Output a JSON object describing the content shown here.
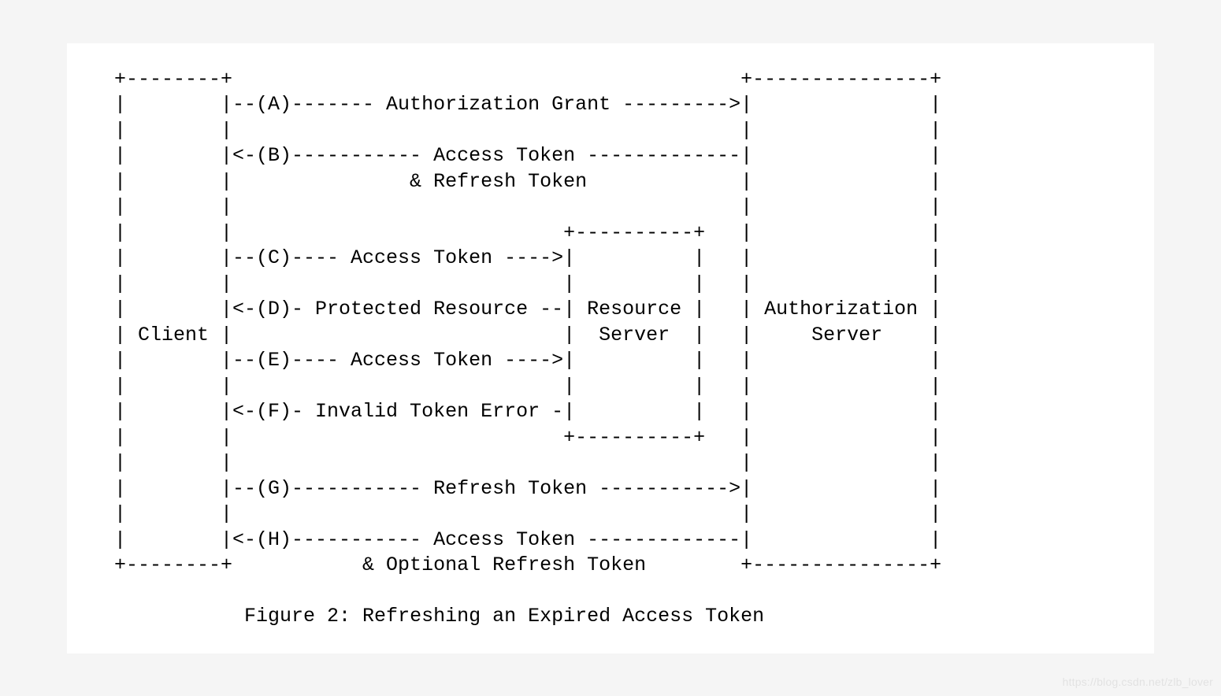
{
  "diagram": {
    "ascii": "+--------+                                           +---------------+\n|        |--(A)------- Authorization Grant --------->|               |\n|        |                                           |               |\n|        |<-(B)----------- Access Token -------------|               |\n|        |               & Refresh Token             |               |\n|        |                                           |               |\n|        |                            +----------+   |               |\n|        |--(C)---- Access Token ---->|          |   |               |\n|        |                            |          |   |               |\n|        |<-(D)- Protected Resource --| Resource |   | Authorization |\n| Client |                            |  Server  |   |     Server    |\n|        |--(E)---- Access Token ---->|          |   |               |\n|        |                            |          |   |               |\n|        |<-(F)- Invalid Token Error -|          |   |               |\n|        |                            +----------+   |               |\n|        |                                           |               |\n|        |--(G)----------- Refresh Token ----------->|               |\n|        |                                           |               |\n|        |<-(H)----------- Access Token -------------|               |\n+--------+           & Optional Refresh Token        +---------------+",
    "caption": "Figure 2: Refreshing an Expired Access Token",
    "entities": {
      "client": "Client",
      "resource_server": "Resource Server",
      "authorization_server": "Authorization Server"
    },
    "steps": [
      {
        "label": "A",
        "from": "Client",
        "to": "Authorization Server",
        "message": "Authorization Grant",
        "direction": "->"
      },
      {
        "label": "B",
        "from": "Authorization Server",
        "to": "Client",
        "message": "Access Token & Refresh Token",
        "direction": "<-"
      },
      {
        "label": "C",
        "from": "Client",
        "to": "Resource Server",
        "message": "Access Token",
        "direction": "->"
      },
      {
        "label": "D",
        "from": "Resource Server",
        "to": "Client",
        "message": "Protected Resource",
        "direction": "<-"
      },
      {
        "label": "E",
        "from": "Client",
        "to": "Resource Server",
        "message": "Access Token",
        "direction": "->"
      },
      {
        "label": "F",
        "from": "Resource Server",
        "to": "Client",
        "message": "Invalid Token Error",
        "direction": "<-"
      },
      {
        "label": "G",
        "from": "Client",
        "to": "Authorization Server",
        "message": "Refresh Token",
        "direction": "->"
      },
      {
        "label": "H",
        "from": "Authorization Server",
        "to": "Client",
        "message": "Access Token & Optional Refresh Token",
        "direction": "<-"
      }
    ]
  },
  "watermark": "https://blog.csdn.net/zlb_lover"
}
